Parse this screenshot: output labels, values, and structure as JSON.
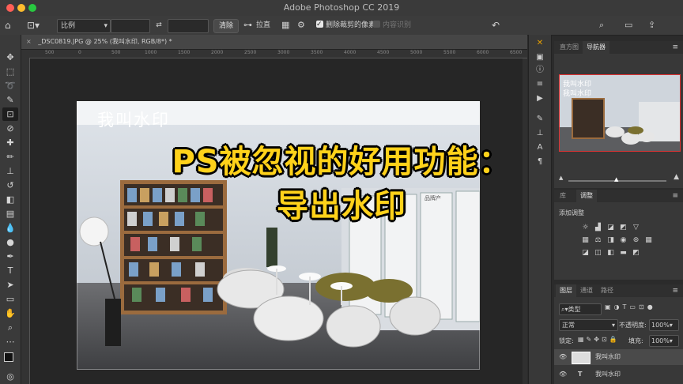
{
  "window": {
    "title": "Adobe Photoshop CC 2019"
  },
  "options_bar": {
    "ratio_select": "比例",
    "clear_label": "清除",
    "straighten_label": "拉直",
    "delete_cropped_label": "删除裁剪的像素",
    "content_aware_label": "内容识别"
  },
  "document": {
    "tab_title": "_DSC0819.JPG @ 25% (我叫水印, RGB/8*) *"
  },
  "ruler": {
    "h_marks": [
      "500",
      "0",
      "500",
      "1000",
      "1500",
      "2000",
      "2500",
      "3000",
      "3500",
      "4000",
      "4500",
      "5000",
      "5500",
      "6000",
      "6500"
    ]
  },
  "image": {
    "watermark": "我叫水印",
    "headline_line1": "PS被忽视的好用功能：",
    "headline_line2": "导出水印",
    "board_text": "品牌产"
  },
  "navigator": {
    "tabs": [
      "直方图",
      "导航器"
    ],
    "active_tab": "导航器",
    "preview_watermark_1": "我叫水印",
    "preview_watermark_2": "我叫水印"
  },
  "adjustments": {
    "tabs": [
      "库",
      "调整"
    ],
    "active_tab": "调整",
    "add_label": "添加调整"
  },
  "layers": {
    "tabs": [
      "图层",
      "通道",
      "路径"
    ],
    "active_tab": "图层",
    "kind_filter": "类型",
    "blend_mode": "正常",
    "opacity_label": "不透明度:",
    "opacity_value": "100%",
    "lock_label": "锁定:",
    "fill_label": "填充:",
    "fill_value": "100%",
    "items": [
      {
        "name": "我叫水印",
        "type": "smart"
      },
      {
        "name": "我叫水印",
        "type": "text"
      }
    ]
  },
  "colors": {
    "headline": "#ffd21a",
    "accent_close": "#ff5f57",
    "accent_min": "#febc2e",
    "accent_max": "#28c840"
  }
}
